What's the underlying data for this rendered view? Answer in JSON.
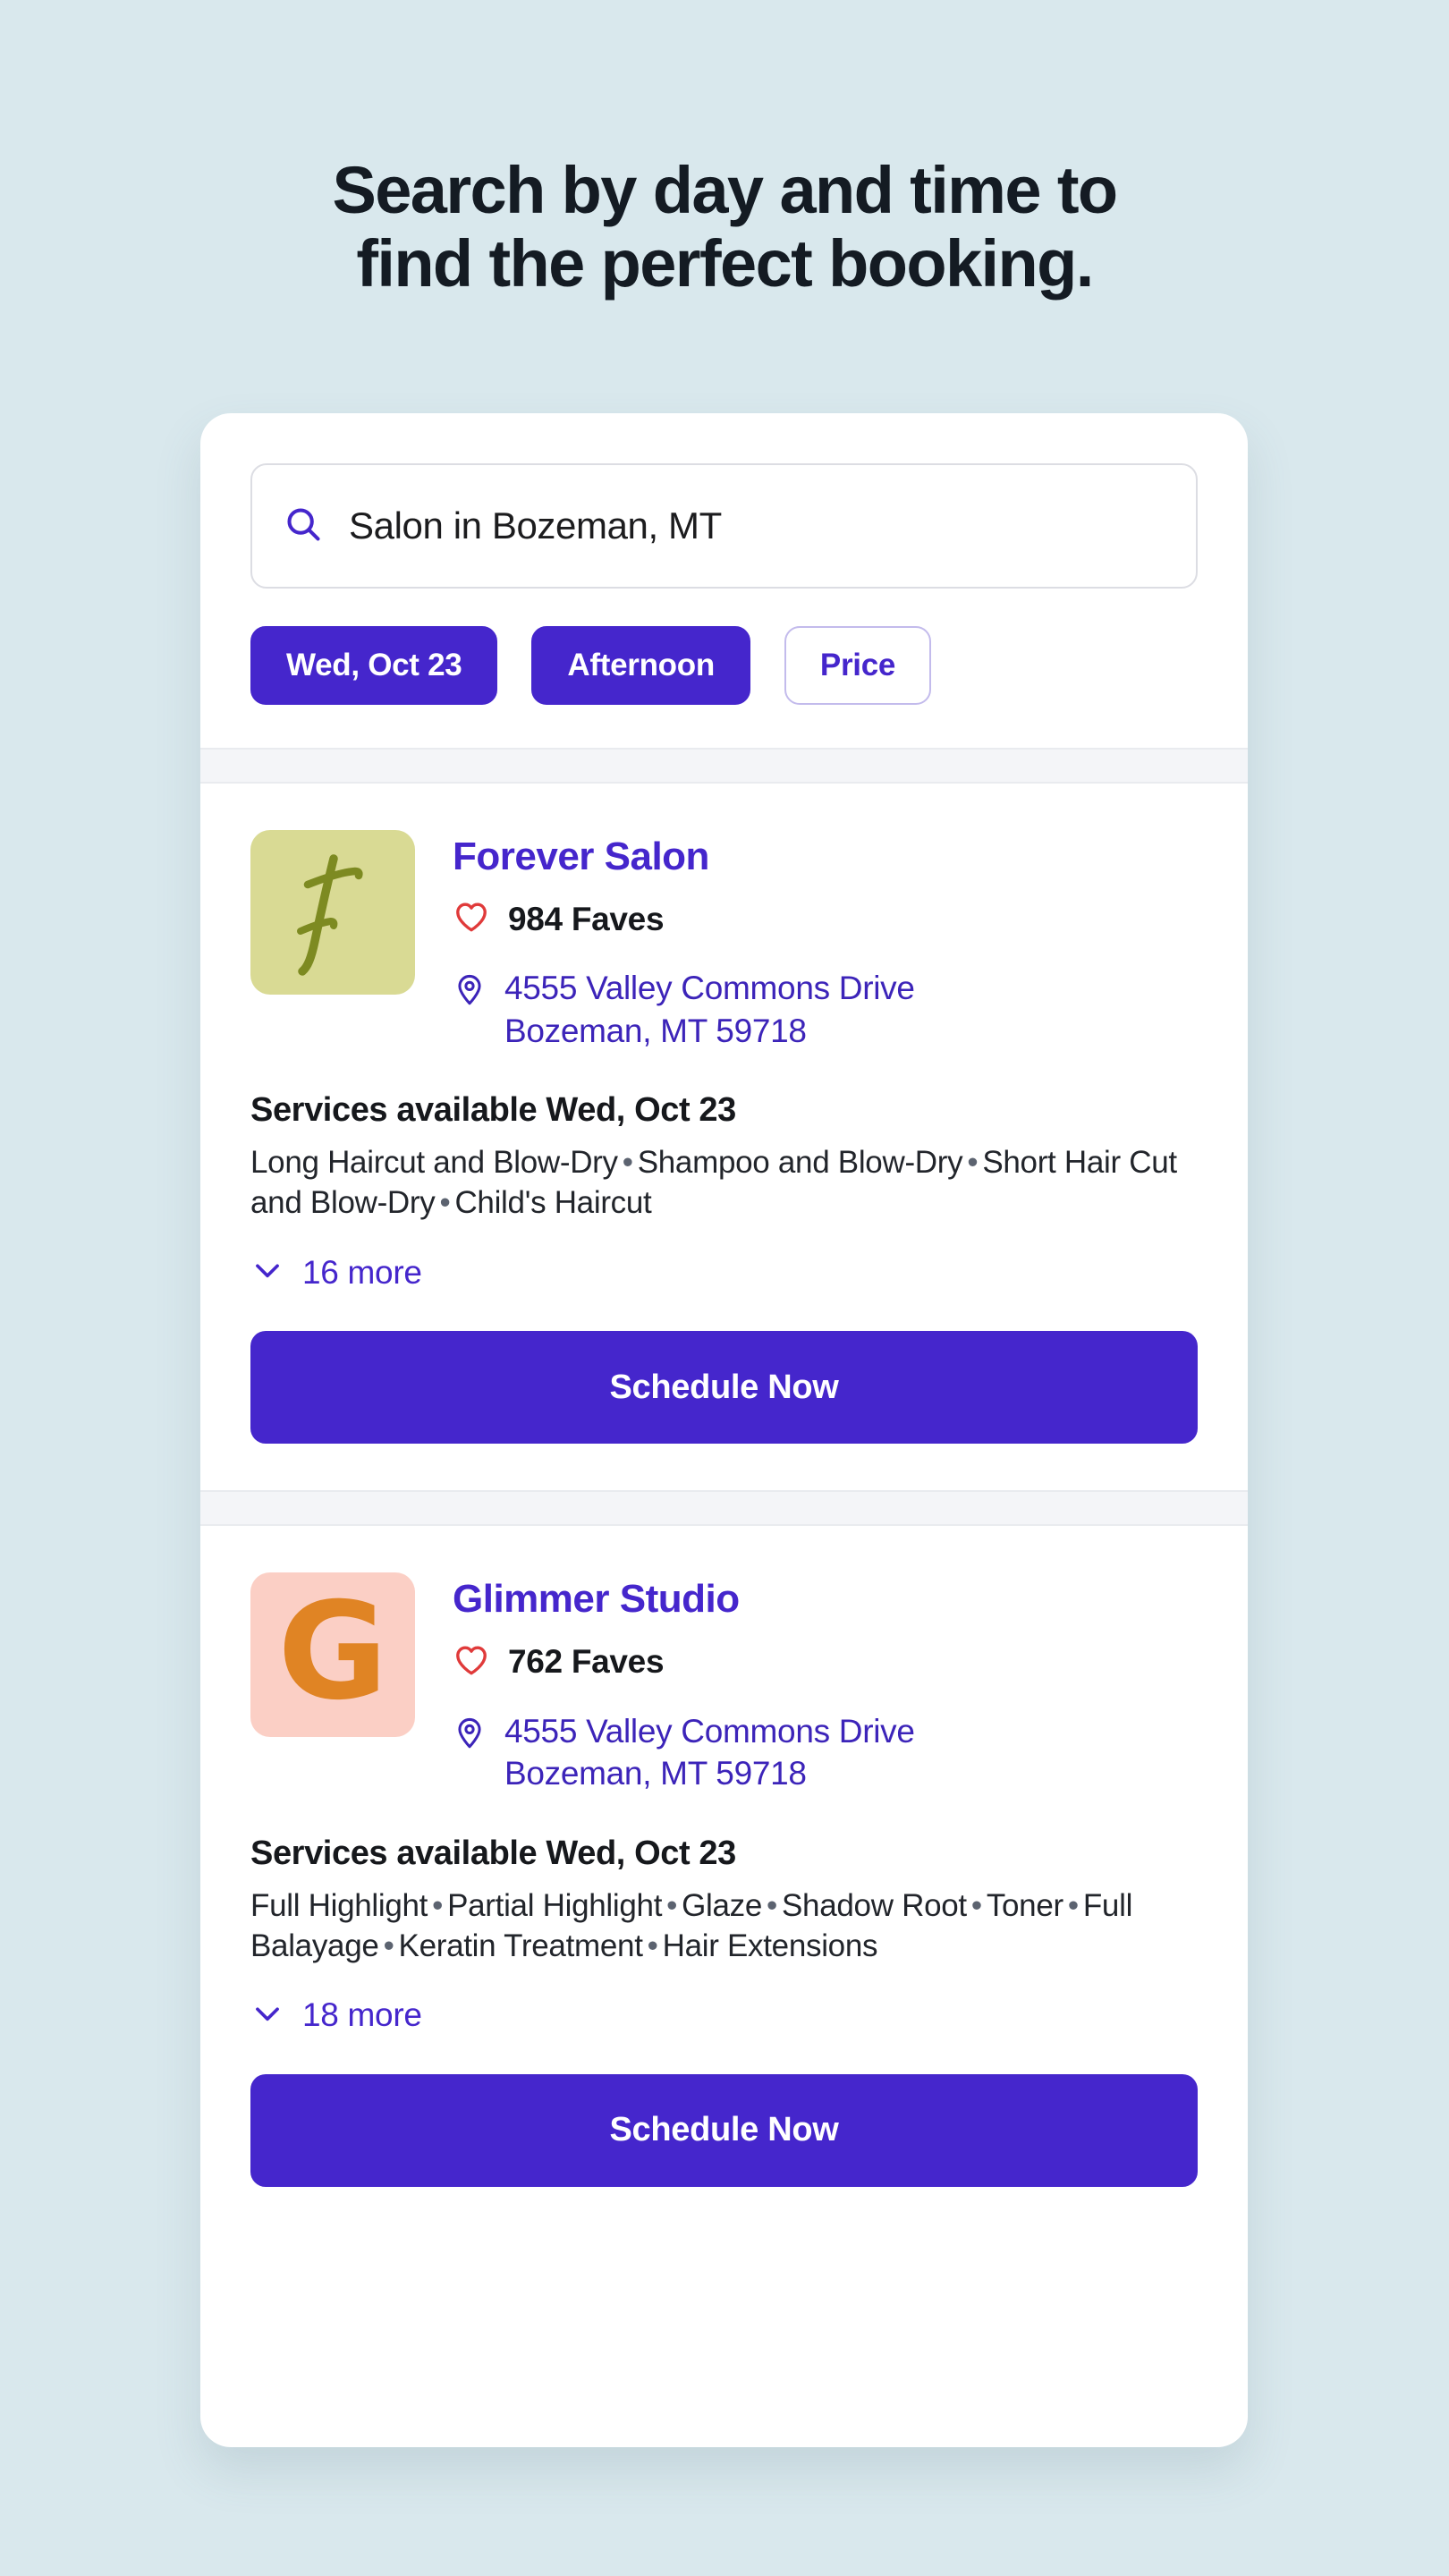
{
  "headline": {
    "line1": "Search by day and time to",
    "line2": "find the perfect booking."
  },
  "search": {
    "icon": "search-icon",
    "value": "Salon in Bozeman, MT",
    "placeholder": "Search"
  },
  "filters": [
    {
      "label": "Wed, Oct 23",
      "style": "filled",
      "name": "filter-date"
    },
    {
      "label": "Afternoon",
      "style": "filled",
      "name": "filter-time"
    },
    {
      "label": "Price",
      "style": "outline",
      "name": "filter-price"
    }
  ],
  "results": [
    {
      "logo": {
        "type": "script-f-logo",
        "letter": "f",
        "bg": "#d9da94",
        "fg": "#7d8a21"
      },
      "name": "Forever Salon",
      "faves_icon": "heart-icon",
      "faves": "984 Faves",
      "pin_icon": "location-pin-icon",
      "address_line1": "4555 Valley Commons Drive",
      "address_line2": "Bozeman, MT 59718",
      "services_title": "Services available Wed, Oct 23",
      "services": [
        "Long Haircut and Blow-Dry",
        "Shampoo and Blow-Dry",
        "Short Hair Cut and Blow-Dry",
        "Child's Haircut"
      ],
      "more_icon": "chevron-down-icon",
      "more_label": "16 more",
      "cta_label": "Schedule Now"
    },
    {
      "logo": {
        "type": "letter-g-logo",
        "letter": "G",
        "bg": "#fbcfc5",
        "fg": "#e08424"
      },
      "name": "Glimmer Studio",
      "faves_icon": "heart-icon",
      "faves": "762 Faves",
      "pin_icon": "location-pin-icon",
      "address_line1": "4555 Valley Commons Drive",
      "address_line2": "Bozeman, MT 59718",
      "services_title": "Services available Wed, Oct 23",
      "services": [
        "Full Highlight",
        "Partial Highlight",
        "Glaze",
        "Shadow Root",
        "Toner",
        "Full Balayage",
        "Keratin Treatment",
        "Hair Extensions"
      ],
      "more_icon": "chevron-down-icon",
      "more_label": "18 more",
      "cta_label": "Schedule Now"
    }
  ],
  "colors": {
    "page_bg": "#d9e8ed",
    "accent_purple": "#4526cc",
    "heart_red": "#e03a3a",
    "headline": "#141b23",
    "band": "#f4f5f8"
  }
}
